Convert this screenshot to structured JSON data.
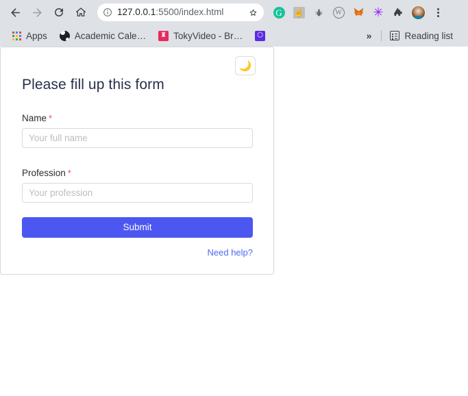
{
  "browser": {
    "nav": {
      "back_icon": "arrow-left-icon",
      "forward_icon": "arrow-right-icon",
      "reload_icon": "reload-icon",
      "home_icon": "home-icon"
    },
    "omnibox": {
      "info_icon": "site-info-icon",
      "url_host": "127.0.0.1",
      "url_path": ":5500/index.html",
      "url_full": "127.0.0.1:5500/index.html",
      "bookmark_icon": "star-outline-icon"
    },
    "extensions": [
      {
        "name": "grammarly-extension-icon",
        "glyph": "G"
      },
      {
        "name": "hand-cursor-extension-icon",
        "glyph": "☝"
      },
      {
        "name": "bug-extension-icon",
        "glyph": "⚙"
      },
      {
        "name": "w-extension-icon",
        "glyph": "W"
      },
      {
        "name": "metamask-fox-extension-icon",
        "glyph": "🦊"
      },
      {
        "name": "purple-asterisk-extension-icon",
        "glyph": "✳"
      },
      {
        "name": "puzzle-extensions-icon",
        "glyph": "❖"
      }
    ],
    "profile": {
      "name": "profile-avatar"
    },
    "menu": {
      "name": "chrome-menu-icon"
    },
    "bookmarks": {
      "items": [
        {
          "icon": "apps-grid-icon",
          "label": "Apps"
        },
        {
          "icon": "globe-icon",
          "label": "Academic Cale…"
        },
        {
          "icon": "tokyvideo-icon",
          "label": "TokyVideo - Br…",
          "glyph": "♜"
        },
        {
          "icon": "dropbox-icon",
          "label": "",
          "glyph": "⬡"
        }
      ],
      "overflow_label": "»",
      "reading_list_label": "Reading list",
      "reading_list_icon": "reading-list-icon"
    }
  },
  "page": {
    "card": {
      "title": "Please fill up this form",
      "theme_toggle": {
        "icon": "crescent-moon-icon",
        "glyph": "🌙"
      },
      "fields": [
        {
          "label": "Name",
          "required_marker": "*",
          "placeholder": "Your full name",
          "value": ""
        },
        {
          "label": "Profession",
          "required_marker": "*",
          "placeholder": "Your profession",
          "value": ""
        }
      ],
      "submit_label": "Submit",
      "help_link_label": "Need help?"
    }
  },
  "colors": {
    "chrome_bg": "#dee1e6",
    "accent_submit": "#4b57f0",
    "link_blue": "#4b6cf0",
    "required_red": "#f4436c",
    "title_navy": "#25304a",
    "placeholder_gray": "#bdbdbd",
    "card_border": "#d6d6d6"
  }
}
